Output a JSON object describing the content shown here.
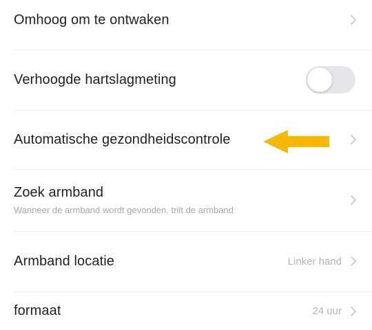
{
  "settings": {
    "rows": [
      {
        "title": "Omhoog om te ontwaken",
        "control": "chevron"
      },
      {
        "title": "Verhoogde hartslagmeting",
        "control": "toggle",
        "toggle_on": false
      },
      {
        "title": "Automatische gezondheidscontrole",
        "control": "chevron",
        "highlighted_by": "arrow-icon"
      },
      {
        "title": "Zoek armband",
        "subtitle": "Wanneer de armband wordt gevonden, trilt de armband",
        "control": "chevron"
      },
      {
        "title": "Armband locatie",
        "value": "Linker hand",
        "control": "chevron"
      },
      {
        "title": "formaat",
        "value": "24 uur",
        "control": "chevron"
      }
    ]
  },
  "annotation": {
    "icon": "arrow-icon",
    "color": "#f5b800",
    "direction": "left"
  },
  "colors": {
    "text_primary": "#1f1f1f",
    "text_secondary": "#b3b3b3",
    "divider": "#ececec",
    "toggle_off": "#e5e5ea"
  }
}
